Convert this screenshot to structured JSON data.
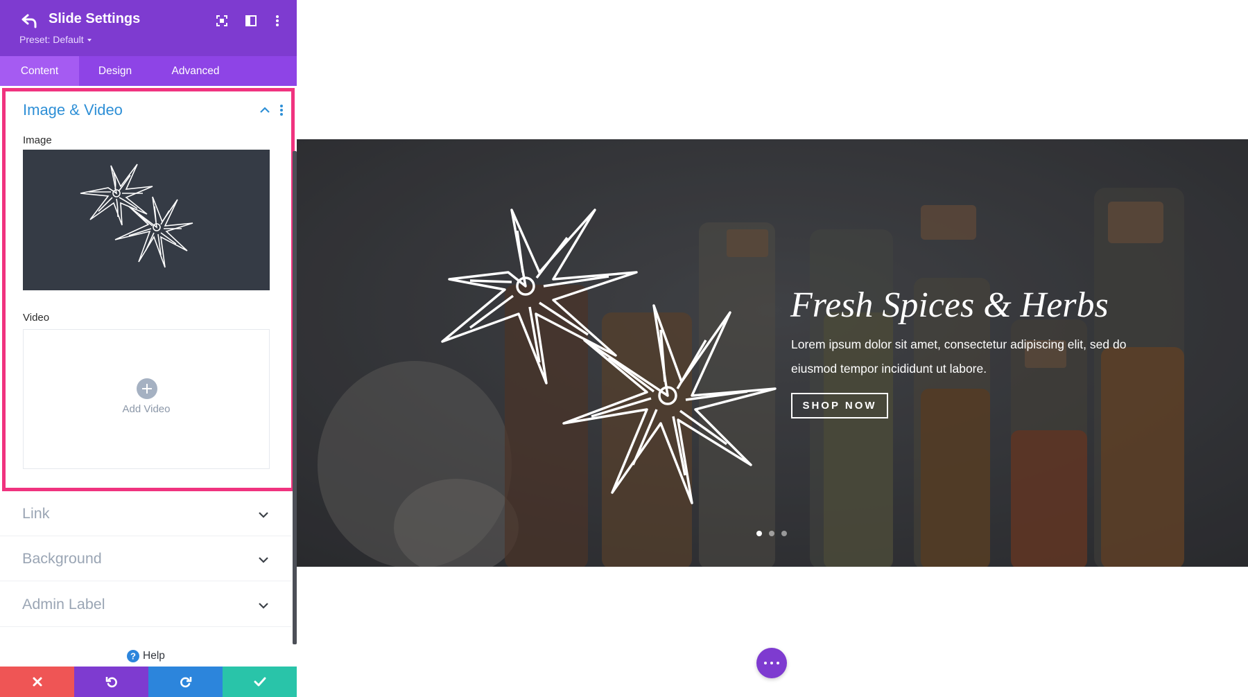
{
  "panel": {
    "title": "Slide Settings",
    "preset": "Preset: Default",
    "tabs": [
      {
        "label": "Content",
        "active": true
      },
      {
        "label": "Design",
        "active": false
      },
      {
        "label": "Advanced",
        "active": false
      }
    ],
    "open_section": {
      "title": "Image & Video",
      "image_label": "Image",
      "video_label": "Video",
      "add_video_label": "Add Video"
    },
    "collapsed_sections": [
      "Link",
      "Background",
      "Admin Label"
    ],
    "help_label": "Help"
  },
  "slide": {
    "title": "Fresh Spices & Herbs",
    "body": "Lorem ipsum dolor sit amet, consectetur adipiscing elit, sed do eiusmod tempor incididunt ut labore.",
    "button_label": "SHOP NOW",
    "dots_count": 3,
    "active_dot": 1
  },
  "colors": {
    "header_purple": "#7e3bd0",
    "tab_purple": "#8e44e6",
    "section_highlight": "#f0337f",
    "section_title_blue": "#2e8fd6",
    "cancel_red": "#ef5555",
    "redo_blue": "#2c85dc",
    "save_green": "#29c4a9"
  },
  "icons": [
    "back-arrow-icon",
    "expand-icon",
    "layout-icon",
    "kebab-icon",
    "chevron-up-icon",
    "chevron-down-icon",
    "plus-icon",
    "help-icon",
    "close-icon",
    "undo-icon",
    "redo-icon",
    "check-icon",
    "star-anise-illustration"
  ]
}
